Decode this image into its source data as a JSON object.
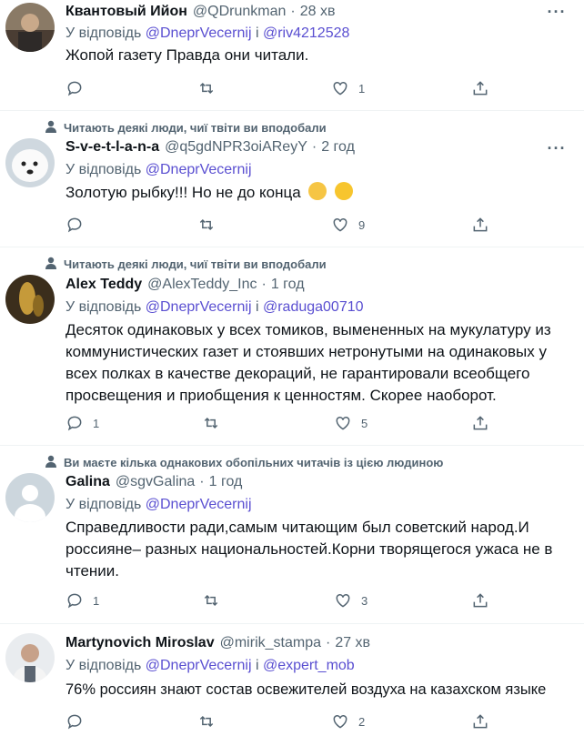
{
  "tweets": [
    {
      "social": "",
      "name": "Квантовый Ийон",
      "handle": "@QDrunkman",
      "time": "28 хв",
      "reply_prefix": "У відповідь",
      "mentions": [
        "@DneprVecernij",
        "@riv4212528"
      ],
      "mention_sep": "і",
      "text": "Жопой газету Правда они читали.",
      "reply_count": "",
      "like_count": "1"
    },
    {
      "social": "Читають деякі люди, чиї твіти ви вподобали",
      "name": "S-v-e-t-l-a-n-a",
      "handle": "@q5gdNPR3oiAReyY",
      "time": "2 год",
      "reply_prefix": "У відповідь",
      "mentions": [
        "@DneprVecernij"
      ],
      "mention_sep": "",
      "text": "Золотую рыбку!!! Но не до конца",
      "reply_count": "",
      "like_count": "9"
    },
    {
      "social": "Читають деякі люди, чиї твіти ви вподобали",
      "name": "Alex Teddy",
      "handle": "@AlexTeddy_Inc",
      "time": "1 год",
      "reply_prefix": "У відповідь",
      "mentions": [
        "@DneprVecernij",
        "@raduga00710"
      ],
      "mention_sep": "і",
      "text_lines": [
        "Десяток одинаковых у всех томиков, вымененных на мукулатуру из",
        "коммунистических газет и стоявших нетронутыми на одинаковых у",
        "всех полках в качестве декораций, не гарантировали всеобщего",
        "просвещения и приобщения к ценностям. Скорее наоборот."
      ],
      "reply_count": "1",
      "like_count": "5"
    },
    {
      "social": "Ви маєте кілька однакових обопільних читачів із цією людиною",
      "name": "Galina",
      "handle": "@sgvGalina",
      "time": "1 год",
      "reply_prefix": "У відповідь",
      "mentions": [
        "@DneprVecernij"
      ],
      "mention_sep": "",
      "text_lines": [
        "Справедливости ради,самым читающим был советский народ.И",
        "россияне– разных национальностей.Корни творящегося ужаса не в",
        "чтении."
      ],
      "reply_count": "1",
      "like_count": "3"
    },
    {
      "social": "",
      "name": "Martynovich Miroslav",
      "handle": "@mirik_stampa",
      "time": "27 хв",
      "reply_prefix": "У відповідь",
      "mentions": [
        "@DneprVecernij",
        "@expert_mob"
      ],
      "mention_sep": "і",
      "text": "76% россиян знают состав освежителей воздуха на казахском языке",
      "reply_count": "",
      "like_count": "2"
    }
  ],
  "dot": "·",
  "more_glyph": "···",
  "colors": {
    "accent": "#5a4fd1",
    "muted": "#536471",
    "text": "#0f1419",
    "divider": "#eff3f4"
  },
  "icons": [
    "reply-icon",
    "retweet-icon",
    "like-icon",
    "share-icon",
    "more-icon",
    "person-icon"
  ]
}
